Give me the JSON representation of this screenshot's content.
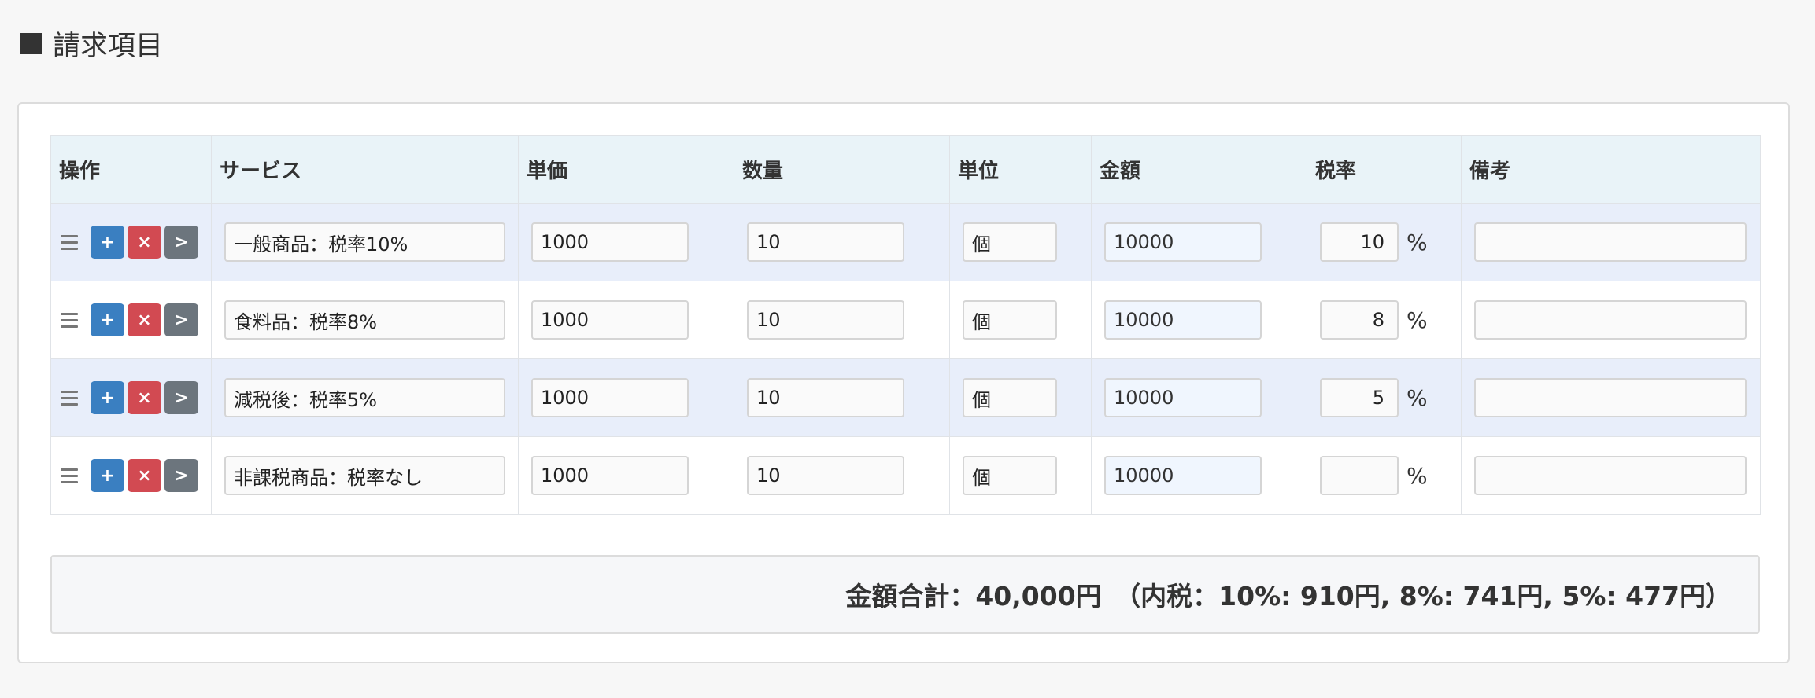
{
  "section": {
    "title": "請求項目"
  },
  "table": {
    "headers": [
      "操作",
      "サービス",
      "単価",
      "数量",
      "単位",
      "金額",
      "税率",
      "備考"
    ],
    "row_actions": {
      "add": "+",
      "delete": "×",
      "move": ">"
    },
    "rows": [
      {
        "service": "一般商品：税率10%",
        "unit_price": "1000",
        "quantity": "10",
        "unit": "個",
        "amount": "10000",
        "tax_rate": "10",
        "tax_suffix": "%",
        "note": ""
      },
      {
        "service": "食料品：税率8%",
        "unit_price": "1000",
        "quantity": "10",
        "unit": "個",
        "amount": "10000",
        "tax_rate": "8",
        "tax_suffix": "%",
        "note": ""
      },
      {
        "service": "減税後：税率5%",
        "unit_price": "1000",
        "quantity": "10",
        "unit": "個",
        "amount": "10000",
        "tax_rate": "5",
        "tax_suffix": "%",
        "note": ""
      },
      {
        "service": "非課税商品：税率なし",
        "unit_price": "1000",
        "quantity": "10",
        "unit": "個",
        "amount": "10000",
        "tax_rate": "",
        "tax_suffix": "%",
        "note": ""
      }
    ]
  },
  "summary": {
    "text": "金額合計：40,000円　（内税：10%: 910円, 8%: 741円, 5%: 477円）"
  },
  "colors": {
    "add": "#3a7fc1",
    "delete": "#d24a52",
    "move": "#6c757d",
    "header_bg": "#e9f3f8",
    "alt_row_bg": "#e8eefa"
  }
}
